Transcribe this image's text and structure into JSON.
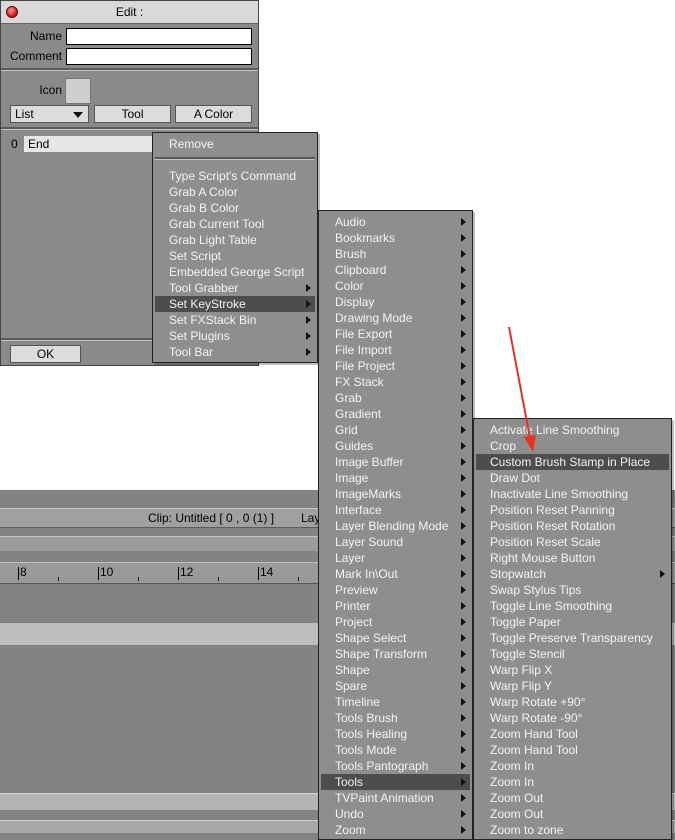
{
  "edit_window": {
    "title": "Edit :",
    "name_label": "Name",
    "name_value": "",
    "comment_label": "Comment",
    "comment_value": "",
    "icon_label": "Icon",
    "list_select": "List",
    "tool_button": "Tool",
    "color_button": "A Color",
    "row_index": "0",
    "row_label": "End",
    "ok_button": "OK"
  },
  "background_window": {
    "clip_text": "Clip: Untitled [ 0 , 0  (1) ]",
    "layer_text": "Lay",
    "ruler_labels": [
      "8",
      "10",
      "12",
      "14"
    ]
  },
  "context_menu": {
    "items": [
      {
        "label": "Remove",
        "submenu": false
      },
      {
        "label": "Type Script's Command",
        "submenu": false
      },
      {
        "label": "Grab A Color",
        "submenu": false
      },
      {
        "label": "Grab B Color",
        "submenu": false
      },
      {
        "label": "Grab Current Tool",
        "submenu": false
      },
      {
        "label": "Grab Light Table",
        "submenu": false
      },
      {
        "label": "Set Script",
        "submenu": false
      },
      {
        "label": "Embedded George Script",
        "submenu": false
      },
      {
        "label": "Tool Grabber",
        "submenu": true
      },
      {
        "label": "Set KeyStroke",
        "submenu": true,
        "highlighted": true
      },
      {
        "label": "Set FXStack Bin",
        "submenu": true
      },
      {
        "label": "Set Plugins",
        "submenu": true
      },
      {
        "label": "Tool Bar",
        "submenu": true
      }
    ]
  },
  "keystroke_menu": {
    "items": [
      "Audio",
      "Bookmarks",
      "Brush",
      "Clipboard",
      "Color",
      "Display",
      "Drawing Mode",
      "File Export",
      "File Import",
      "File Project",
      "FX Stack",
      "Grab",
      "Gradient",
      "Grid",
      "Guides",
      "Image Buffer",
      "Image",
      "ImageMarks",
      "Interface",
      "Layer Blending Mode",
      "Layer Sound",
      "Layer",
      "Mark In\\Out",
      "Preview",
      "Printer",
      "Project",
      "Shape Select",
      "Shape Transform",
      "Shape",
      "Spare",
      "Timeline",
      "Tools Brush",
      "Tools Healing",
      "Tools Mode",
      "Tools Pantograph",
      "Tools",
      "TVPaint Animation",
      "Undo",
      "Zoom"
    ],
    "highlighted": "Tools"
  },
  "tools_menu": {
    "items": [
      {
        "label": "Activate Line Smoothing"
      },
      {
        "label": "Crop"
      },
      {
        "label": "Custom Brush Stamp in Place",
        "highlighted": true
      },
      {
        "label": "Draw Dot"
      },
      {
        "label": "Inactivate Line Smoothing"
      },
      {
        "label": "Position Reset Panning"
      },
      {
        "label": "Position Reset Rotation"
      },
      {
        "label": "Position Reset Scale"
      },
      {
        "label": "Right Mouse Button"
      },
      {
        "label": "Stopwatch",
        "submenu": true
      },
      {
        "label": "Swap Stylus Tips"
      },
      {
        "label": "Toggle Line Smoothing"
      },
      {
        "label": "Toggle Paper"
      },
      {
        "label": "Toggle Preserve Transparency"
      },
      {
        "label": "Toggle Stencil"
      },
      {
        "label": "Warp Flip X"
      },
      {
        "label": "Warp Flip Y"
      },
      {
        "label": "Warp Rotate +90°"
      },
      {
        "label": "Warp Rotate -90°"
      },
      {
        "label": "Zoom Hand Tool"
      },
      {
        "label": "Zoom Hand Tool"
      },
      {
        "label": "Zoom In"
      },
      {
        "label": "Zoom In"
      },
      {
        "label": "Zoom Out"
      },
      {
        "label": "Zoom Out"
      },
      {
        "label": "Zoom to zone"
      }
    ]
  },
  "colors": {
    "menu_bg": "#8e8e8e",
    "menu_highlight": "#4d4d4d",
    "menu_text": "#f4f4f4",
    "annotation_arrow": "#e8321e"
  }
}
